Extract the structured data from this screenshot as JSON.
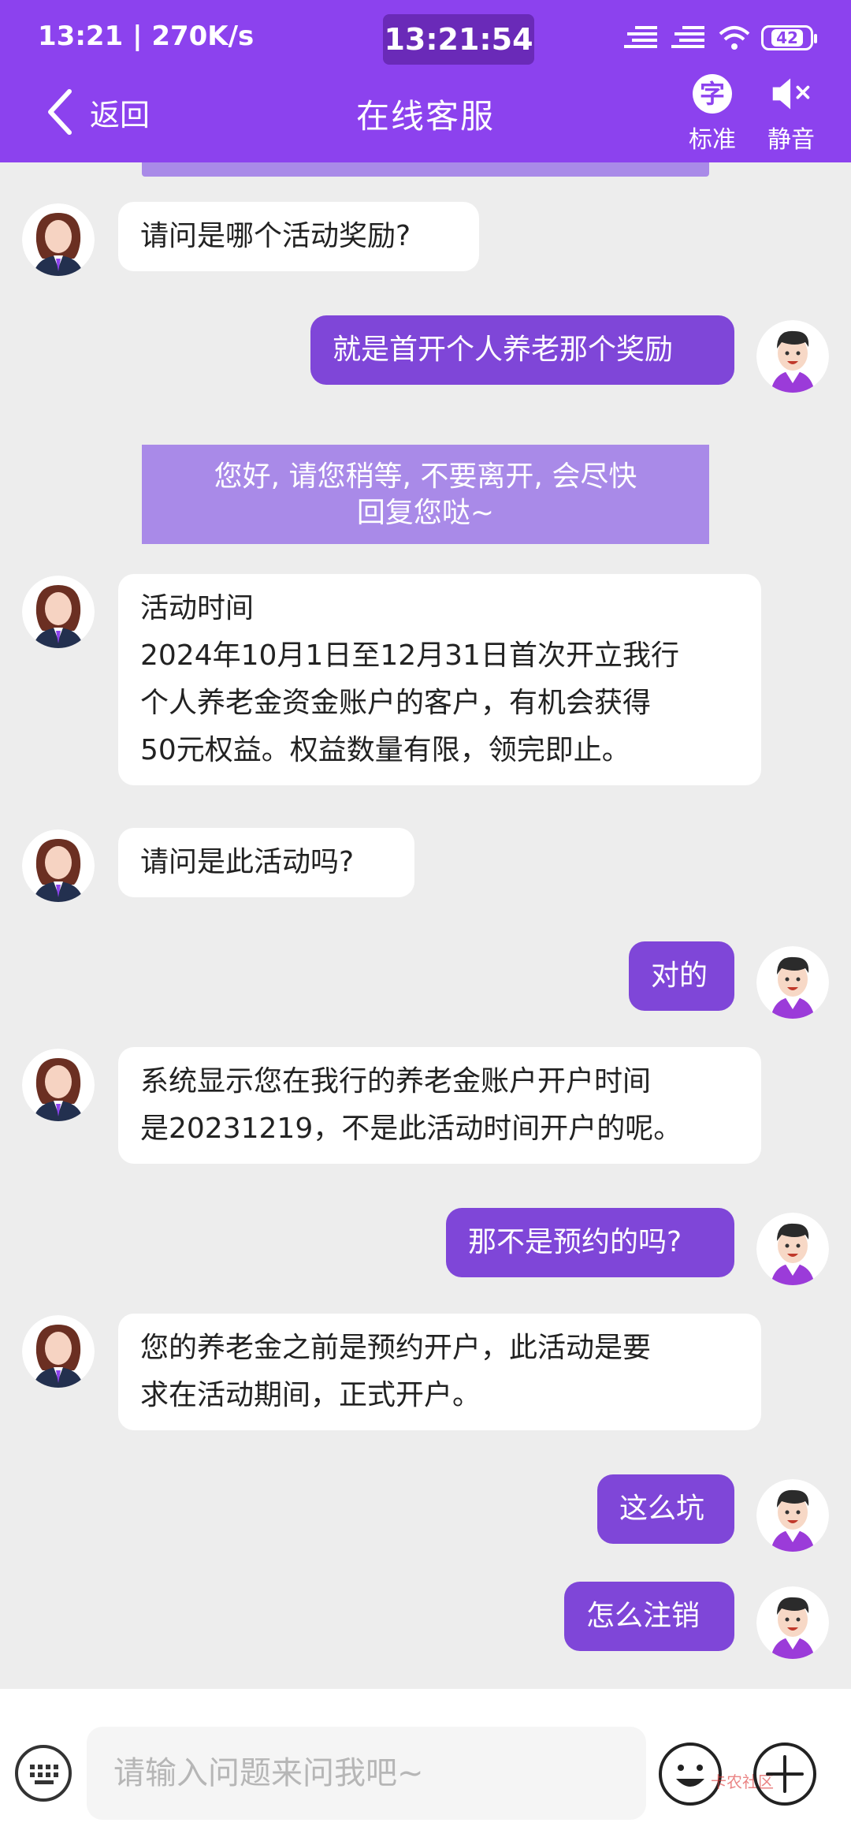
{
  "status_bar": {
    "left_text": "13:21 | 270K/s",
    "clock": "13:21:54",
    "battery": "42"
  },
  "header": {
    "back_label": "返回",
    "title": "在线客服",
    "font_btn_icon": "字",
    "font_btn_label": "标准",
    "mute_label": "静音"
  },
  "messages": [
    {
      "from": "agent",
      "lines": [
        "请问是哪个活动奖励?"
      ]
    },
    {
      "from": "user",
      "lines": [
        "就是首开个人养老那个奖励"
      ]
    },
    {
      "from": "system",
      "lines": [
        "您好, 请您稍等, 不要离开, 会尽快",
        "回复您哒~"
      ]
    },
    {
      "from": "agent",
      "lines": [
        "活动时间",
        "2024年10月1日至12月31日首次开立我行",
        "个人养老金资金账户的客户，有机会获得",
        "50元权益。权益数量有限，领完即止。"
      ]
    },
    {
      "from": "agent",
      "lines": [
        "请问是此活动吗?"
      ]
    },
    {
      "from": "user",
      "lines": [
        "对的"
      ]
    },
    {
      "from": "agent",
      "lines": [
        "系统显示您在我行的养老金账户开户时间",
        "是20231219，不是此活动时间开户的呢。"
      ]
    },
    {
      "from": "user",
      "lines": [
        "那不是预约的吗?"
      ]
    },
    {
      "from": "agent",
      "lines": [
        "您的养老金之前是预约开户，此活动是要",
        "求在活动期间，正式开户。"
      ]
    },
    {
      "from": "user",
      "lines": [
        "这么坑"
      ]
    },
    {
      "from": "user",
      "lines": [
        "怎么注销"
      ]
    }
  ],
  "input": {
    "placeholder": "请输入问题来问我吧~"
  },
  "watermark": "卡农社区",
  "icons": {
    "back": "chevron-left-icon",
    "mute": "speaker-mute-icon",
    "keyboard": "keyboard-icon",
    "emoji": "smiley-icon",
    "plus": "plus-icon"
  },
  "colors": {
    "header": "#8c42ee",
    "user_bubble": "#7f46d8",
    "system_note": "#a98ae8",
    "background": "#ededed"
  }
}
